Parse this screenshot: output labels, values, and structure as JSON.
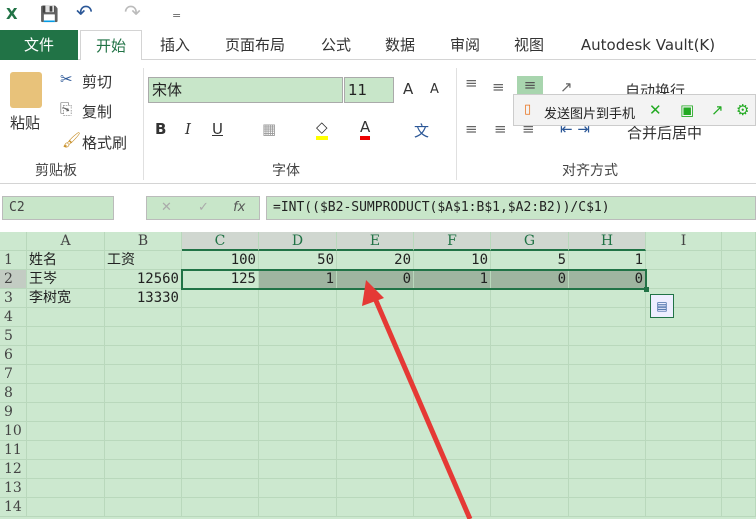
{
  "qat": {
    "excel": "X",
    "save": "💾",
    "undo": "↶",
    "redo": "↷",
    "more": "="
  },
  "tabs": [
    "文件",
    "开始",
    "插入",
    "页面布局",
    "公式",
    "数据",
    "审阅",
    "视图",
    "Autodesk Vault(K)"
  ],
  "clipboard": {
    "paste": "粘贴",
    "cut": "剪切",
    "copy": "复制",
    "format_painter": "格式刷",
    "group": "剪贴板"
  },
  "font": {
    "name": "宋体",
    "size": "11",
    "bold": "B",
    "italic": "I",
    "underline": "U",
    "group": "字体",
    "grow": "A",
    "shrink": "A",
    "phonetic": "文"
  },
  "align": {
    "wrap": "自动换行",
    "merge": "合并后居中",
    "group": "对齐方式"
  },
  "popup": {
    "send": "发送图片到手机"
  },
  "formula_bar": {
    "name_box": "C2",
    "cancel": "✕",
    "enter": "✓",
    "fx": "fx",
    "formula": "=INT(($B2-SUMPRODUCT($A$1:B$1,$A2:B2))/C$1)"
  },
  "sheet": {
    "columns": [
      "A",
      "B",
      "C",
      "D",
      "E",
      "F",
      "G",
      "H",
      "I"
    ],
    "rows": [
      [
        "姓名",
        "工资",
        "100",
        "50",
        "20",
        "10",
        "5",
        "1",
        ""
      ],
      [
        "王岑",
        "12560",
        "125",
        "1",
        "0",
        "1",
        "0",
        "0",
        ""
      ],
      [
        "李树宽",
        "13330",
        "",
        "",
        "",
        "",
        "",
        "",
        ""
      ]
    ],
    "row_count": 15,
    "selected": "C2:H2",
    "accent": "#217346"
  }
}
